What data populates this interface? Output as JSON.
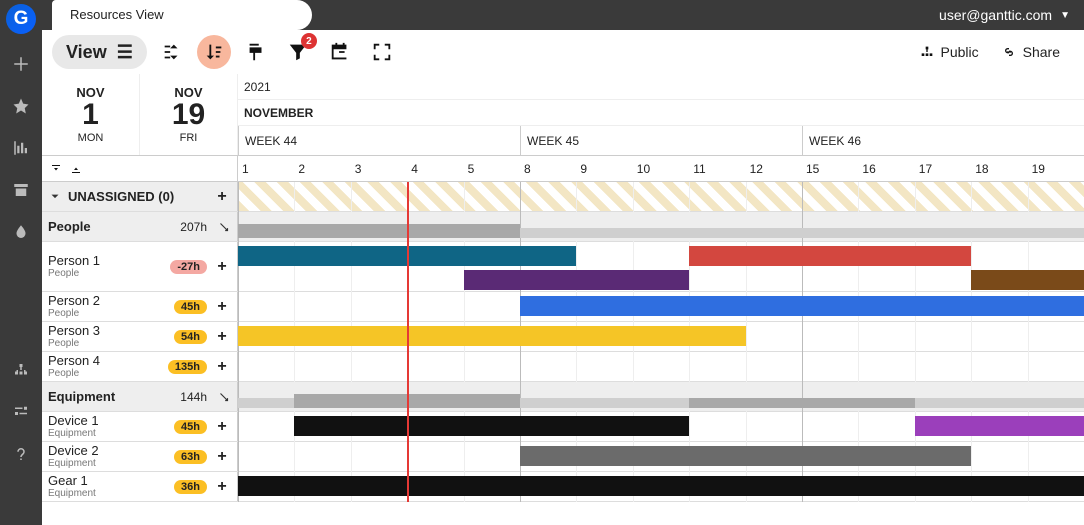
{
  "header": {
    "tab_title": "Resources View",
    "user_email": "user@ganttic.com"
  },
  "toolbar": {
    "view_label": "View",
    "filter_badge": "2",
    "public_label": "Public",
    "share_label": "Share"
  },
  "range": {
    "start_month": "NOV",
    "start_day": "1",
    "start_wd": "MON",
    "end_month": "NOV",
    "end_day": "19",
    "end_wd": "FRI",
    "year": "2021",
    "month_name": "NOVEMBER",
    "weeks": [
      "WEEK 44",
      "WEEK 45",
      "WEEK 46"
    ]
  },
  "days": [
    "1",
    "2",
    "3",
    "4",
    "5",
    "8",
    "9",
    "10",
    "11",
    "12",
    "15",
    "16",
    "17",
    "18",
    "19"
  ],
  "groups": [
    {
      "name": "UNASSIGNED (0)",
      "type": "unassigned"
    },
    {
      "name": "People",
      "hours": "207h",
      "type": "group"
    },
    {
      "name": "Person 1",
      "sub": "People",
      "hours": "-27h",
      "neg": true,
      "type": "resource",
      "bars": [
        {
          "color": "dkteal",
          "start": 0,
          "span": 6,
          "row": 0
        },
        {
          "color": "red",
          "start": 8,
          "span": 5,
          "row": 0
        },
        {
          "color": "purple",
          "start": 4,
          "span": 4,
          "row": 1
        },
        {
          "color": "brown",
          "start": 13,
          "span": 2,
          "row": 1
        }
      ],
      "dbl": true
    },
    {
      "name": "Person 2",
      "sub": "People",
      "hours": "45h",
      "type": "resource",
      "bars": [
        {
          "color": "blue",
          "start": 5,
          "span": 10,
          "row": 0
        }
      ]
    },
    {
      "name": "Person 3",
      "sub": "People",
      "hours": "54h",
      "type": "resource",
      "bars": [
        {
          "color": "yellow",
          "start": 0,
          "span": 9,
          "row": 0
        }
      ]
    },
    {
      "name": "Person 4",
      "sub": "People",
      "hours": "135h",
      "type": "resource",
      "bars": []
    },
    {
      "name": "Equipment",
      "hours": "144h",
      "type": "group"
    },
    {
      "name": "Device 1",
      "sub": "Equipment",
      "hours": "45h",
      "type": "resource",
      "bars": [
        {
          "color": "black",
          "start": 1,
          "span": 7,
          "row": 0
        },
        {
          "color": "violet",
          "start": 12,
          "span": 3,
          "row": 0
        }
      ]
    },
    {
      "name": "Device 2",
      "sub": "Equipment",
      "hours": "63h",
      "type": "resource",
      "bars": [
        {
          "color": "dkgray",
          "start": 5,
          "span": 8,
          "row": 0
        }
      ]
    },
    {
      "name": "Gear 1",
      "sub": "Equipment",
      "hours": "36h",
      "type": "resource",
      "bars": [
        {
          "color": "black",
          "start": 0,
          "span": 15,
          "row": 0
        }
      ]
    }
  ],
  "group_bars": {
    "People": [
      {
        "color": "gray",
        "start": 0,
        "width": 5,
        "h": 14
      },
      {
        "color": "ltgray",
        "start": 5,
        "width": 10,
        "h": 10
      }
    ],
    "Equipment": [
      {
        "color": "ltgray",
        "start": 0,
        "width": 1,
        "h": 10
      },
      {
        "color": "gray",
        "start": 1,
        "width": 4,
        "h": 14
      },
      {
        "color": "ltgray",
        "start": 5,
        "width": 3,
        "h": 10
      },
      {
        "color": "gray",
        "start": 8,
        "width": 4,
        "h": 10
      },
      {
        "color": "ltgray",
        "start": 12,
        "width": 3,
        "h": 10
      }
    ]
  }
}
